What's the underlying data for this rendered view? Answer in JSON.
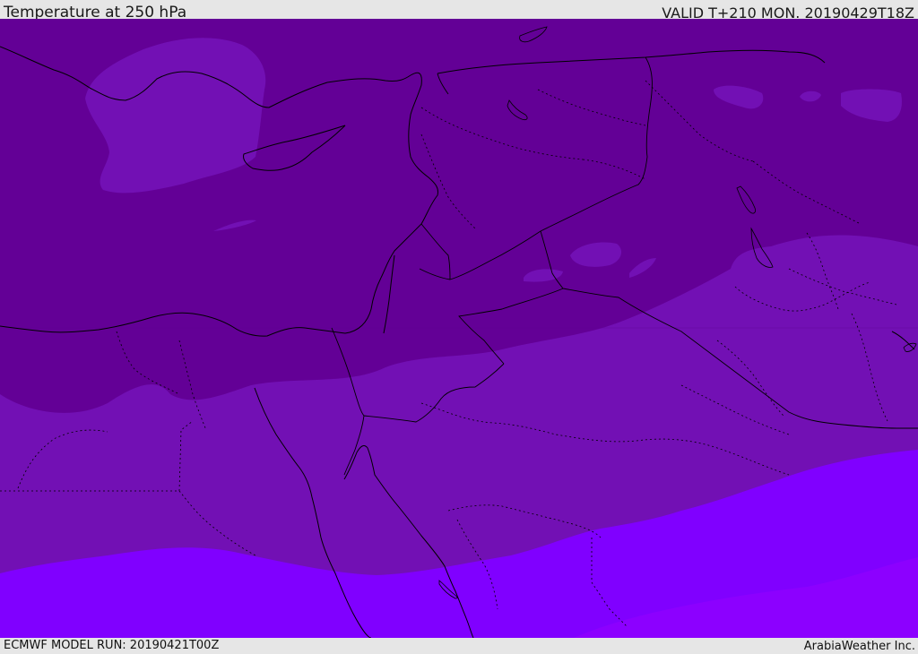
{
  "header": {
    "title": "Temperature at 250 hPa",
    "valid": "VALID T+210 MON. 20190429T18Z"
  },
  "footer": {
    "model_run": "ECMWF MODEL RUN: 20190421T00Z",
    "credit": "ArabiaWeather Inc."
  },
  "map": {
    "colors": {
      "band_dark": "#630096",
      "band_mid_dark": "#7210b4",
      "band_mid": "#7a12c8",
      "band_light": "#8000ff",
      "border_line": "#000000"
    }
  }
}
